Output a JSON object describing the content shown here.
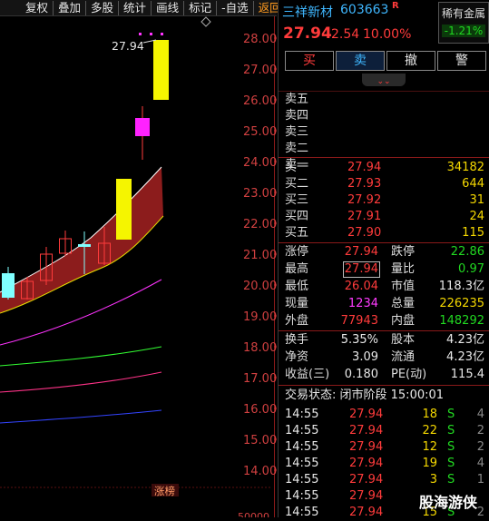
{
  "toolbar": {
    "items": [
      "复权",
      "叠加",
      "多股",
      "统计",
      "画线",
      "标记",
      "-自选",
      "返回"
    ]
  },
  "chart": {
    "y_ticks": [
      "28.00",
      "27.00",
      "26.00",
      "25.00",
      "24.00",
      "23.00",
      "22.00",
      "21.00",
      "20.00",
      "19.00",
      "18.00",
      "17.00",
      "16.00",
      "15.00",
      "14.00"
    ],
    "high_label": "27.94",
    "limit_tag": "涨榜",
    "bottom_number": "50000"
  },
  "stock": {
    "name": "三祥新材",
    "code": "603663",
    "flag": "R",
    "sector": "稀有金属",
    "sector_change": "-1.21%",
    "price": "27.94",
    "change": "2.54",
    "change_pct": "10.00%",
    "collapse_icon": "double-chevron-down"
  },
  "actions": {
    "buy": "买",
    "sell": "卖",
    "cancel": "撤",
    "alert": "警"
  },
  "asks": [
    {
      "label": "卖五"
    },
    {
      "label": "卖四"
    },
    {
      "label": "卖三"
    },
    {
      "label": "卖二"
    },
    {
      "label": "卖一"
    }
  ],
  "bids": [
    {
      "label": "买一",
      "price": "27.94",
      "volume": "34182"
    },
    {
      "label": "买二",
      "price": "27.93",
      "volume": "644"
    },
    {
      "label": "买三",
      "price": "27.92",
      "volume": "31"
    },
    {
      "label": "买四",
      "price": "27.91",
      "volume": "24"
    },
    {
      "label": "买五",
      "price": "27.90",
      "volume": "115"
    }
  ],
  "stats": {
    "limit_up_label": "涨停",
    "limit_up": "27.94",
    "limit_down_label": "跌停",
    "limit_down": "22.86",
    "high_label": "最高",
    "high": "27.94",
    "vol_ratio_label": "量比",
    "vol_ratio": "0.97",
    "low_label": "最低",
    "low": "26.04",
    "mkt_cap_label": "市值",
    "mkt_cap": "118.3亿",
    "cur_vol_label": "现量",
    "cur_vol": "1234",
    "total_vol_label": "总量",
    "total_vol": "226235",
    "outer_label": "外盘",
    "outer": "77943",
    "inner_label": "内盘",
    "inner": "148292"
  },
  "fund": {
    "turnover_label": "换手",
    "turnover": "5.35%",
    "shares_label": "股本",
    "shares": "4.23亿",
    "nav_label": "净资",
    "nav": "3.09",
    "float_label": "流通",
    "float": "4.23亿",
    "eps_label": "收益(三)",
    "eps": "0.180",
    "pe_label": "PE(动)",
    "pe": "115.4"
  },
  "trade_status": "交易状态: 闭市阶段 15:00:01",
  "ticks": [
    {
      "time": "14:55",
      "price": "27.94",
      "vol": "18",
      "side": "S",
      "n": "4"
    },
    {
      "time": "14:55",
      "price": "27.94",
      "vol": "22",
      "side": "S",
      "n": "2"
    },
    {
      "time": "14:55",
      "price": "27.94",
      "vol": "12",
      "side": "S",
      "n": "2"
    },
    {
      "time": "14:55",
      "price": "27.94",
      "vol": "19",
      "side": "S",
      "n": "4"
    },
    {
      "time": "14:55",
      "price": "27.94",
      "vol": "3",
      "side": "S",
      "n": "1"
    },
    {
      "time": "14:55",
      "price": "27.94",
      "vol": "",
      "side": "",
      "n": ""
    },
    {
      "time": "14:55",
      "price": "27.94",
      "vol": "15",
      "side": "S",
      "n": "2"
    }
  ],
  "watermark": "股海游侠",
  "colors": {
    "up": "#ff3b3b",
    "down": "#21d821",
    "accent": "#f5d800"
  }
}
